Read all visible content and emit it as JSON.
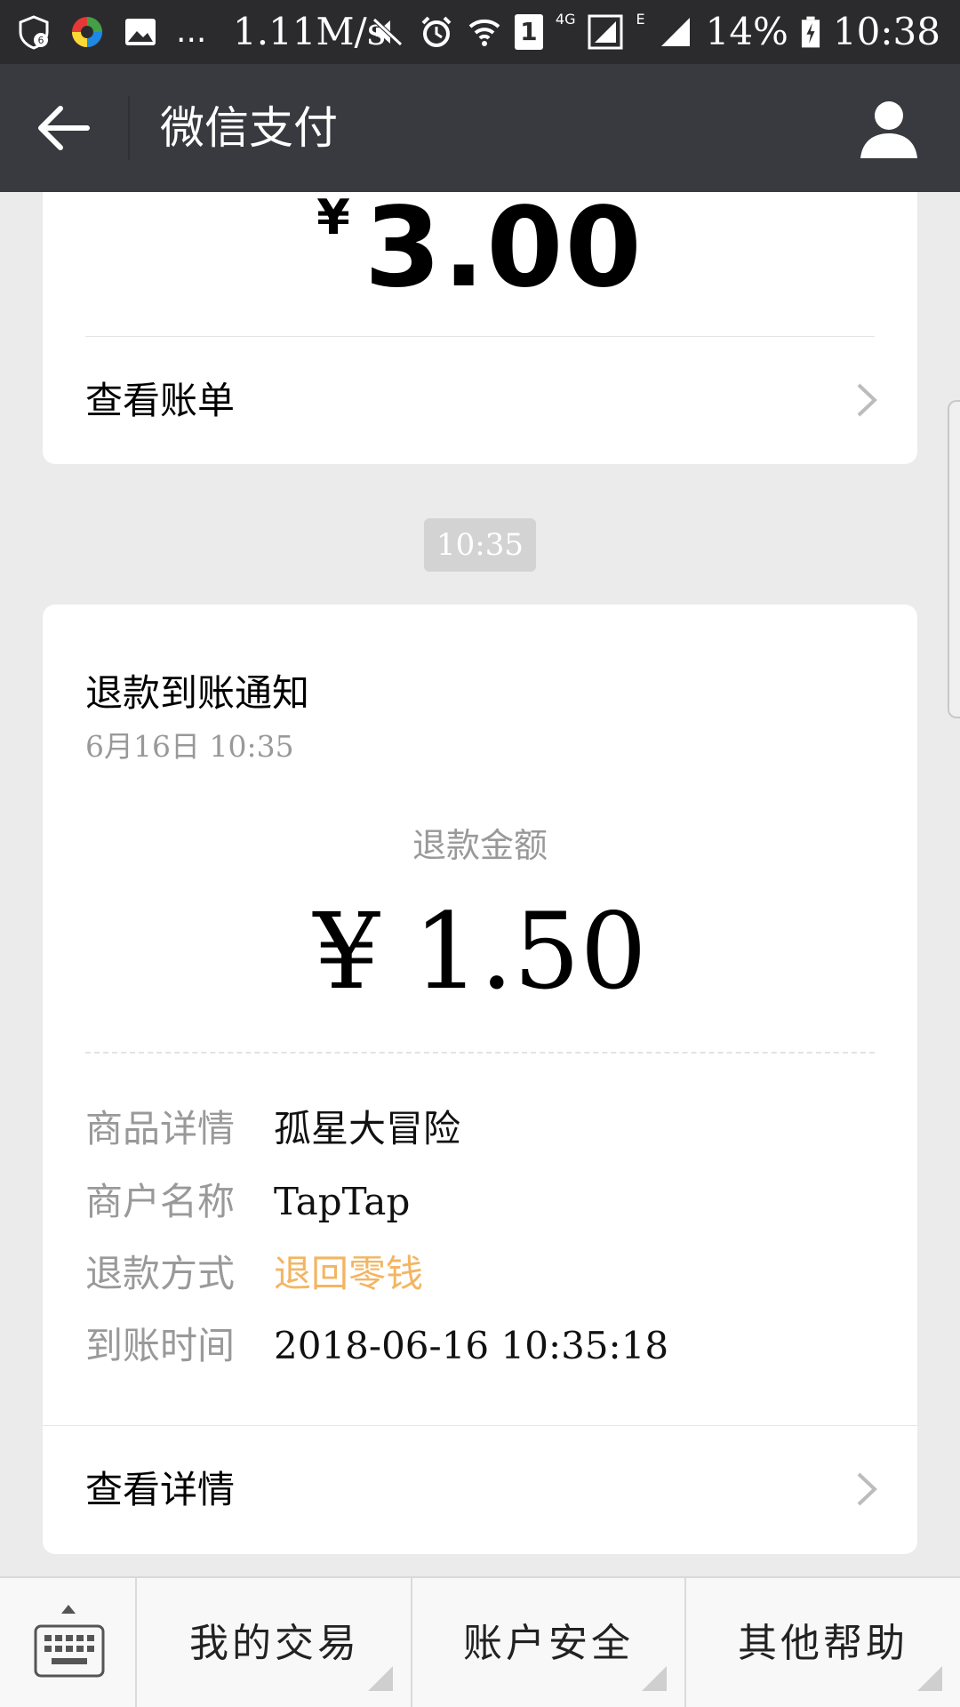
{
  "status_bar": {
    "network_speed": "1.11M/s",
    "more_indicator": "...",
    "sim_badge": "1",
    "network_type_4g": "4G",
    "network_type_e": "E",
    "battery": "14%",
    "time": "10:38",
    "icons": [
      "shield-notification-icon",
      "app-logo-icon",
      "gallery-icon",
      "mute-icon",
      "alarm-icon",
      "wifi-icon",
      "sim-icon",
      "signal-4g-icon",
      "signal-e-icon",
      "battery-charging-icon"
    ]
  },
  "header": {
    "title": "微信支付",
    "back_icon": "arrow-left-icon",
    "profile_icon": "person-icon"
  },
  "previous_card": {
    "currency": "¥",
    "amount": "3.00",
    "link_label": "查看账单"
  },
  "timestamp": "10:35",
  "notice": {
    "title": "退款到账通知",
    "date": "6月16日  10:35",
    "amount_label": "退款金额",
    "amount": "¥ 1.50",
    "details": [
      {
        "key": "商品详情",
        "value": "孤星大冒险"
      },
      {
        "key": "商户名称",
        "value": "TapTap"
      },
      {
        "key": "退款方式",
        "value": "退回零钱"
      },
      {
        "key": "到账时间",
        "value": "2018-06-16 10:35:18"
      }
    ],
    "link_label": "查看详情"
  },
  "bottom_menu": {
    "keyboard_icon": "keyboard-icon",
    "items": [
      {
        "label": "我的交易"
      },
      {
        "label": "账户安全"
      },
      {
        "label": "其他帮助"
      }
    ]
  },
  "colors": {
    "header_bg": "#393a3f",
    "status_bg": "#2b2b2e",
    "page_bg": "#ebebeb",
    "accent_orange": "#f3b562",
    "muted_text": "#999999"
  }
}
